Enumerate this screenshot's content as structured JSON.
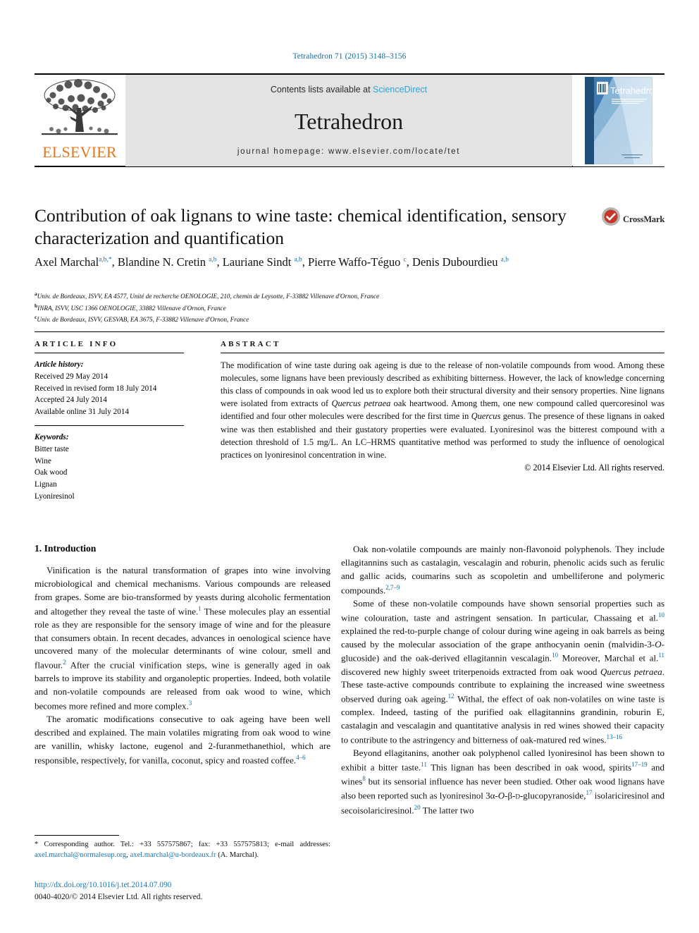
{
  "journal_ref": "Tetrahedron 71 (2015) 3148–3156",
  "masthead": {
    "publisher_name": "ELSEVIER",
    "contents_prefix": "Contents lists available at ",
    "sciencedirect": "ScienceDirect",
    "journal_name": "Tetrahedron",
    "homepage": "journal homepage: www.elsevier.com/locate/tet",
    "cover_title": "Tetrahedron"
  },
  "article": {
    "title": "Contribution of oak lignans to wine taste: chemical identification, sensory characterization and quantification",
    "crossmark_label": "CrossMark",
    "authors_html": "Axel Marchal<sup>a,b,*</sup>, Blandine N. Cretin <sup>a,b</sup>, Lauriane Sindt <sup>a,b</sup>, Pierre Waffo-Téguo <sup>c</sup>, Denis Dubourdieu <sup>a,b</sup>",
    "affiliations": [
      "Univ. de Bordeaux, ISVV, EA 4577, Unité de recherche OENOLOGIE, 210, chemin de Leysotte, F-33882 Villenave d'Ornon, France",
      "INRA, ISVV, USC 1366 OENOLOGIE, 33882 Villenave d'Ornon, France",
      "Univ. de Bordeaux, ISVV, GESVAB, EA 3675, F-33882 Villenave d'Ornon, France"
    ],
    "affiliation_marks": [
      "a",
      "b",
      "c"
    ]
  },
  "article_info": {
    "heading": "ARTICLE INFO",
    "history_label": "Article history:",
    "history": [
      "Received 29 May 2014",
      "Received in revised form 18 July 2014",
      "Accepted 24 July 2014",
      "Available online 31 July 2014"
    ],
    "keywords_label": "Keywords:",
    "keywords": [
      "Bitter taste",
      "Wine",
      "Oak wood",
      "Lignan",
      "Lyoniresinol"
    ]
  },
  "abstract": {
    "heading": "ABSTRACT",
    "text_html": "The modification of wine taste during oak ageing is due to the release of non-volatile compounds from wood. Among these molecules, some lignans have been previously described as exhibiting bitterness. However, the lack of knowledge concerning this class of compounds in oak wood led us to explore both their structural diversity and their sensory properties. Nine lignans were isolated from extracts of <i>Quercus petraea</i> oak heartwood. Among them, one new compound called quercoresinol was identified and four other molecules were described for the first time in <i>Quercus</i> genus. The presence of these lignans in oaked wine was then established and their gustatory properties were evaluated. Lyoniresinol was the bitterest compound with a detection threshold of 1.5 mg/L. An LC–HRMS quantitative method was performed to study the influence of oenological practices on lyoniresinol concentration in wine.",
    "copyright": "© 2014 Elsevier Ltd. All rights reserved."
  },
  "body": {
    "section_heading": "1. Introduction",
    "left_paragraphs_html": [
      "Vinification is the natural transformation of grapes into wine involving microbiological and chemical mechanisms. Various compounds are released from grapes. Some are bio-transformed by yeasts during alcoholic fermentation and altogether they reveal the taste of wine.<sup>1</sup> These molecules play an essential role as they are responsible for the sensory image of wine and for the pleasure that consumers obtain. In recent decades, advances in oenological science have uncovered many of the molecular determinants of wine colour, smell and flavour.<sup>2</sup> After the crucial vinification steps, wine is generally aged in oak barrels to improve its stability and organoleptic properties. Indeed, both volatile and non-volatile compounds are released from oak wood to wine, which becomes more refined and more complex.<sup>3</sup>",
      "The aromatic modifications consecutive to oak ageing have been well described and explained. The main volatiles migrating from oak wood to wine are vanillin, whisky lactone, eugenol and 2-furanmethanethiol, which are responsible, respectively, for vanilla, coconut, spicy and roasted coffee.<sup>4–6</sup>"
    ],
    "right_paragraphs_html": [
      "Oak non-volatile compounds are mainly non-flavonoid polyphenols. They include ellagitannins such as castalagin, vescalagin and roburin, phenolic acids such as ferulic and gallic acids, coumarins such as scopoletin and umbelliferone and polymeric compounds.<sup>2,7–9</sup>",
      "Some of these non-volatile compounds have shown sensorial properties such as wine colouration, taste and astringent sensation. In particular, Chassaing et al.<sup>10</sup> explained the red-to-purple change of colour during wine ageing in oak barrels as being caused by the molecular association of the grape anthocyanin oenin (malvidin-3-<i>O</i>-glucoside) and the oak-derived ellagitannin vescalagin.<sup>10</sup> Moreover, Marchal et al.<sup>11</sup> discovered new highly sweet triterpenoids extracted from oak wood <i>Quercus petraea</i>. These taste-active compounds contribute to explaining the increased wine sweetness observed during oak ageing.<sup>12</sup> Withal, the effect of oak non-volatiles on wine taste is complex. Indeed, tasting of the purified oak ellagitannins grandinin, roburin E, castalagin and vescalagin and quantitative analysis in red wines showed their capacity to contribute to the astringency and bitterness of oak-matured red wines.<sup>13–16</sup>",
      "Beyond ellagitanins, another oak polyphenol called lyoniresinol has been shown to exhibit a bitter taste.<sup>11</sup> This lignan has been described in oak wood, spirits<sup>17–19</sup> and wines<sup>8</sup> but its sensorial influence has never been studied. Other oak wood lignans have also been reported such as lyoniresinol 3α-<i>O</i>-β-<span style=\"font-variant:small-caps\">d</span>-glucopyranoside,<sup>17</sup> isolariciresinol and secoisolariciresinol.<sup>20</sup> The latter two"
    ]
  },
  "footer": {
    "corresponding_html": "* Corresponding author. Tel.: +33 557575867; fax: +33 557575813; e-mail addresses: <a class=\"link\" href=\"#\">axel.marchal@normalesup.org</a>, <a class=\"link\" href=\"#\">axel.marchal@u-bordeaux.fr</a> (A. Marchal).",
    "doi": "http://dx.doi.org/10.1016/j.tet.2014.07.090",
    "issn_line": "0040-4020/© 2014 Elsevier Ltd. All rights reserved."
  },
  "colors": {
    "link_blue": "#1b74b8",
    "header_blue": "#0b6ea8",
    "sciencedirect_blue": "#2ba6de",
    "elsevier_orange": "#e8761b",
    "grey_band": "#e3e3e3"
  }
}
